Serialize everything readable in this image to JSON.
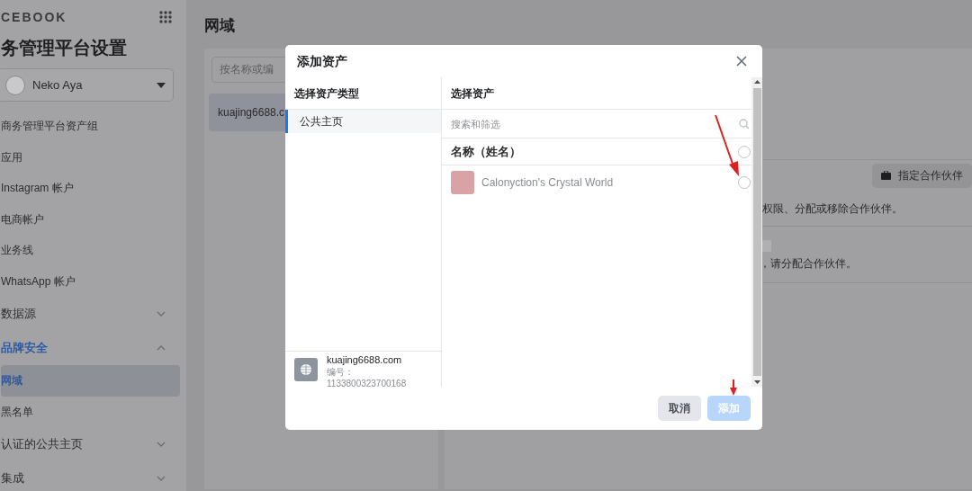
{
  "sidebar": {
    "brand": "CEBOOK",
    "title": "务管理平台设置",
    "account": {
      "name": "Neko Aya"
    },
    "items": [
      {
        "label": "商务管理平台资产组",
        "kind": "link",
        "selected": false
      },
      {
        "label": "应用",
        "kind": "link",
        "selected": false
      },
      {
        "label": "Instagram 帐户",
        "kind": "link",
        "selected": false
      },
      {
        "label": "电商帐户",
        "kind": "link",
        "selected": false
      },
      {
        "label": "业务线",
        "kind": "link",
        "selected": false
      },
      {
        "label": "WhatsApp 帐户",
        "kind": "link",
        "selected": false
      },
      {
        "label": "数据源",
        "kind": "section",
        "expanded": false,
        "selected": false
      },
      {
        "label": "品牌安全",
        "kind": "section",
        "expanded": true,
        "selected": true,
        "children": [
          {
            "label": "网域",
            "kind": "link",
            "selected": true
          },
          {
            "label": "黑名单",
            "kind": "link",
            "selected": false
          }
        ]
      },
      {
        "label": "认证的公共主页",
        "kind": "section",
        "expanded": false,
        "selected": false
      },
      {
        "label": "集成",
        "kind": "section",
        "expanded": false,
        "selected": false
      }
    ]
  },
  "page": {
    "title": "网域",
    "domain_panel": {
      "search_placeholder": "按名称或编",
      "items": [
        {
          "label": "kuajing6688.c",
          "selected": true
        }
      ]
    },
    "partners_panel": {
      "button": "指定合作伙伴",
      "description": "权限、分配或移除合作伙伴。",
      "empty_text": "，请分配合作伙伴。"
    }
  },
  "dialog": {
    "title": "添加资产",
    "type_column": {
      "heading": "选择资产类型",
      "types": [
        {
          "label": "公共主页",
          "selected": true
        }
      ],
      "asset": {
        "name": "kuajing6688.com",
        "id_label": "编号：",
        "id": "1133800323700168"
      }
    },
    "asset_column": {
      "heading": "选择资产",
      "search_placeholder": "搜索和筛选",
      "column_heading": "名称（姓名）",
      "all_checked": false,
      "rows": [
        {
          "name": "Calonyction's Crystal World",
          "checked": false
        }
      ]
    },
    "buttons": [
      {
        "label": "取消",
        "kind": "secondary",
        "disabled": false
      },
      {
        "label": "添加",
        "kind": "primary",
        "disabled": true
      }
    ]
  }
}
